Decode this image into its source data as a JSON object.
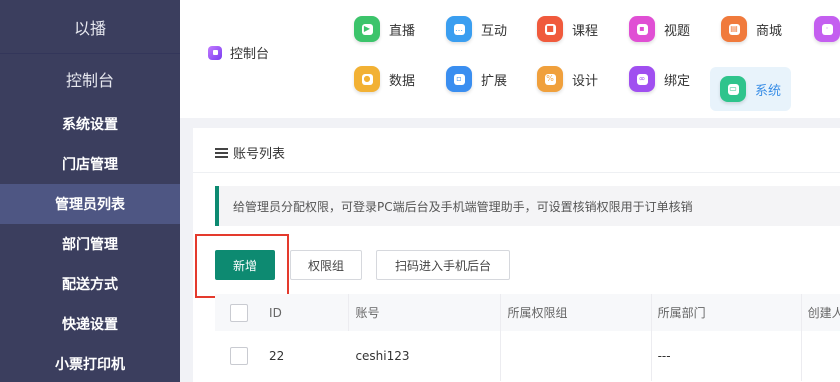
{
  "sidebar": {
    "brand": "以播",
    "header": "控制台",
    "items": [
      {
        "label": "系统设置"
      },
      {
        "label": "门店管理"
      },
      {
        "label": "管理员列表"
      },
      {
        "label": "部门管理"
      },
      {
        "label": "配送方式"
      },
      {
        "label": "快递设置"
      },
      {
        "label": "小票打印机"
      }
    ]
  },
  "topnav": {
    "home": "控制台",
    "items": [
      {
        "label": "直播",
        "icon": "live-icon",
        "color": "#3cc46b"
      },
      {
        "label": "互动",
        "icon": "chat-icon",
        "color": "#3a9ef0"
      },
      {
        "label": "课程",
        "icon": "course-icon",
        "color": "#f05a3c"
      },
      {
        "label": "视题",
        "icon": "video-icon",
        "color": "#e04fd4"
      },
      {
        "label": "商城",
        "icon": "shop-icon",
        "color": "#f07a3c"
      },
      {
        "label": "数据",
        "icon": "data-icon",
        "color": "#f2b134"
      },
      {
        "label": "扩展",
        "icon": "extend-icon",
        "color": "#3a8ef0"
      },
      {
        "label": "设计",
        "icon": "design-icon",
        "color": "#f0a03c"
      },
      {
        "label": "绑定",
        "icon": "bind-icon",
        "color": "#a04ff0"
      },
      {
        "label": "系统",
        "icon": "system-icon",
        "color": "#2fc48c"
      }
    ]
  },
  "panel": {
    "title": "账号列表",
    "notice": "给管理员分配权限，可登录PC端后台及手机端管理助手，可设置核销权限用于订单核销"
  },
  "buttons": {
    "add": "新增",
    "perm_group": "权限组",
    "scan": "扫码进入手机后台"
  },
  "table": {
    "headers": [
      "ID",
      "账号",
      "所属权限组",
      "所属部门",
      "创建人"
    ],
    "rows": [
      {
        "id": "22",
        "account": "ceshi123",
        "group": "",
        "dept": "---"
      }
    ]
  },
  "colors": {
    "sidebar_bg": "#3b3e5e",
    "sidebar_active": "#4e5683",
    "primary": "#0d8a71",
    "highlight": "#e43a2d",
    "active_nav": "#3a8ee6"
  }
}
